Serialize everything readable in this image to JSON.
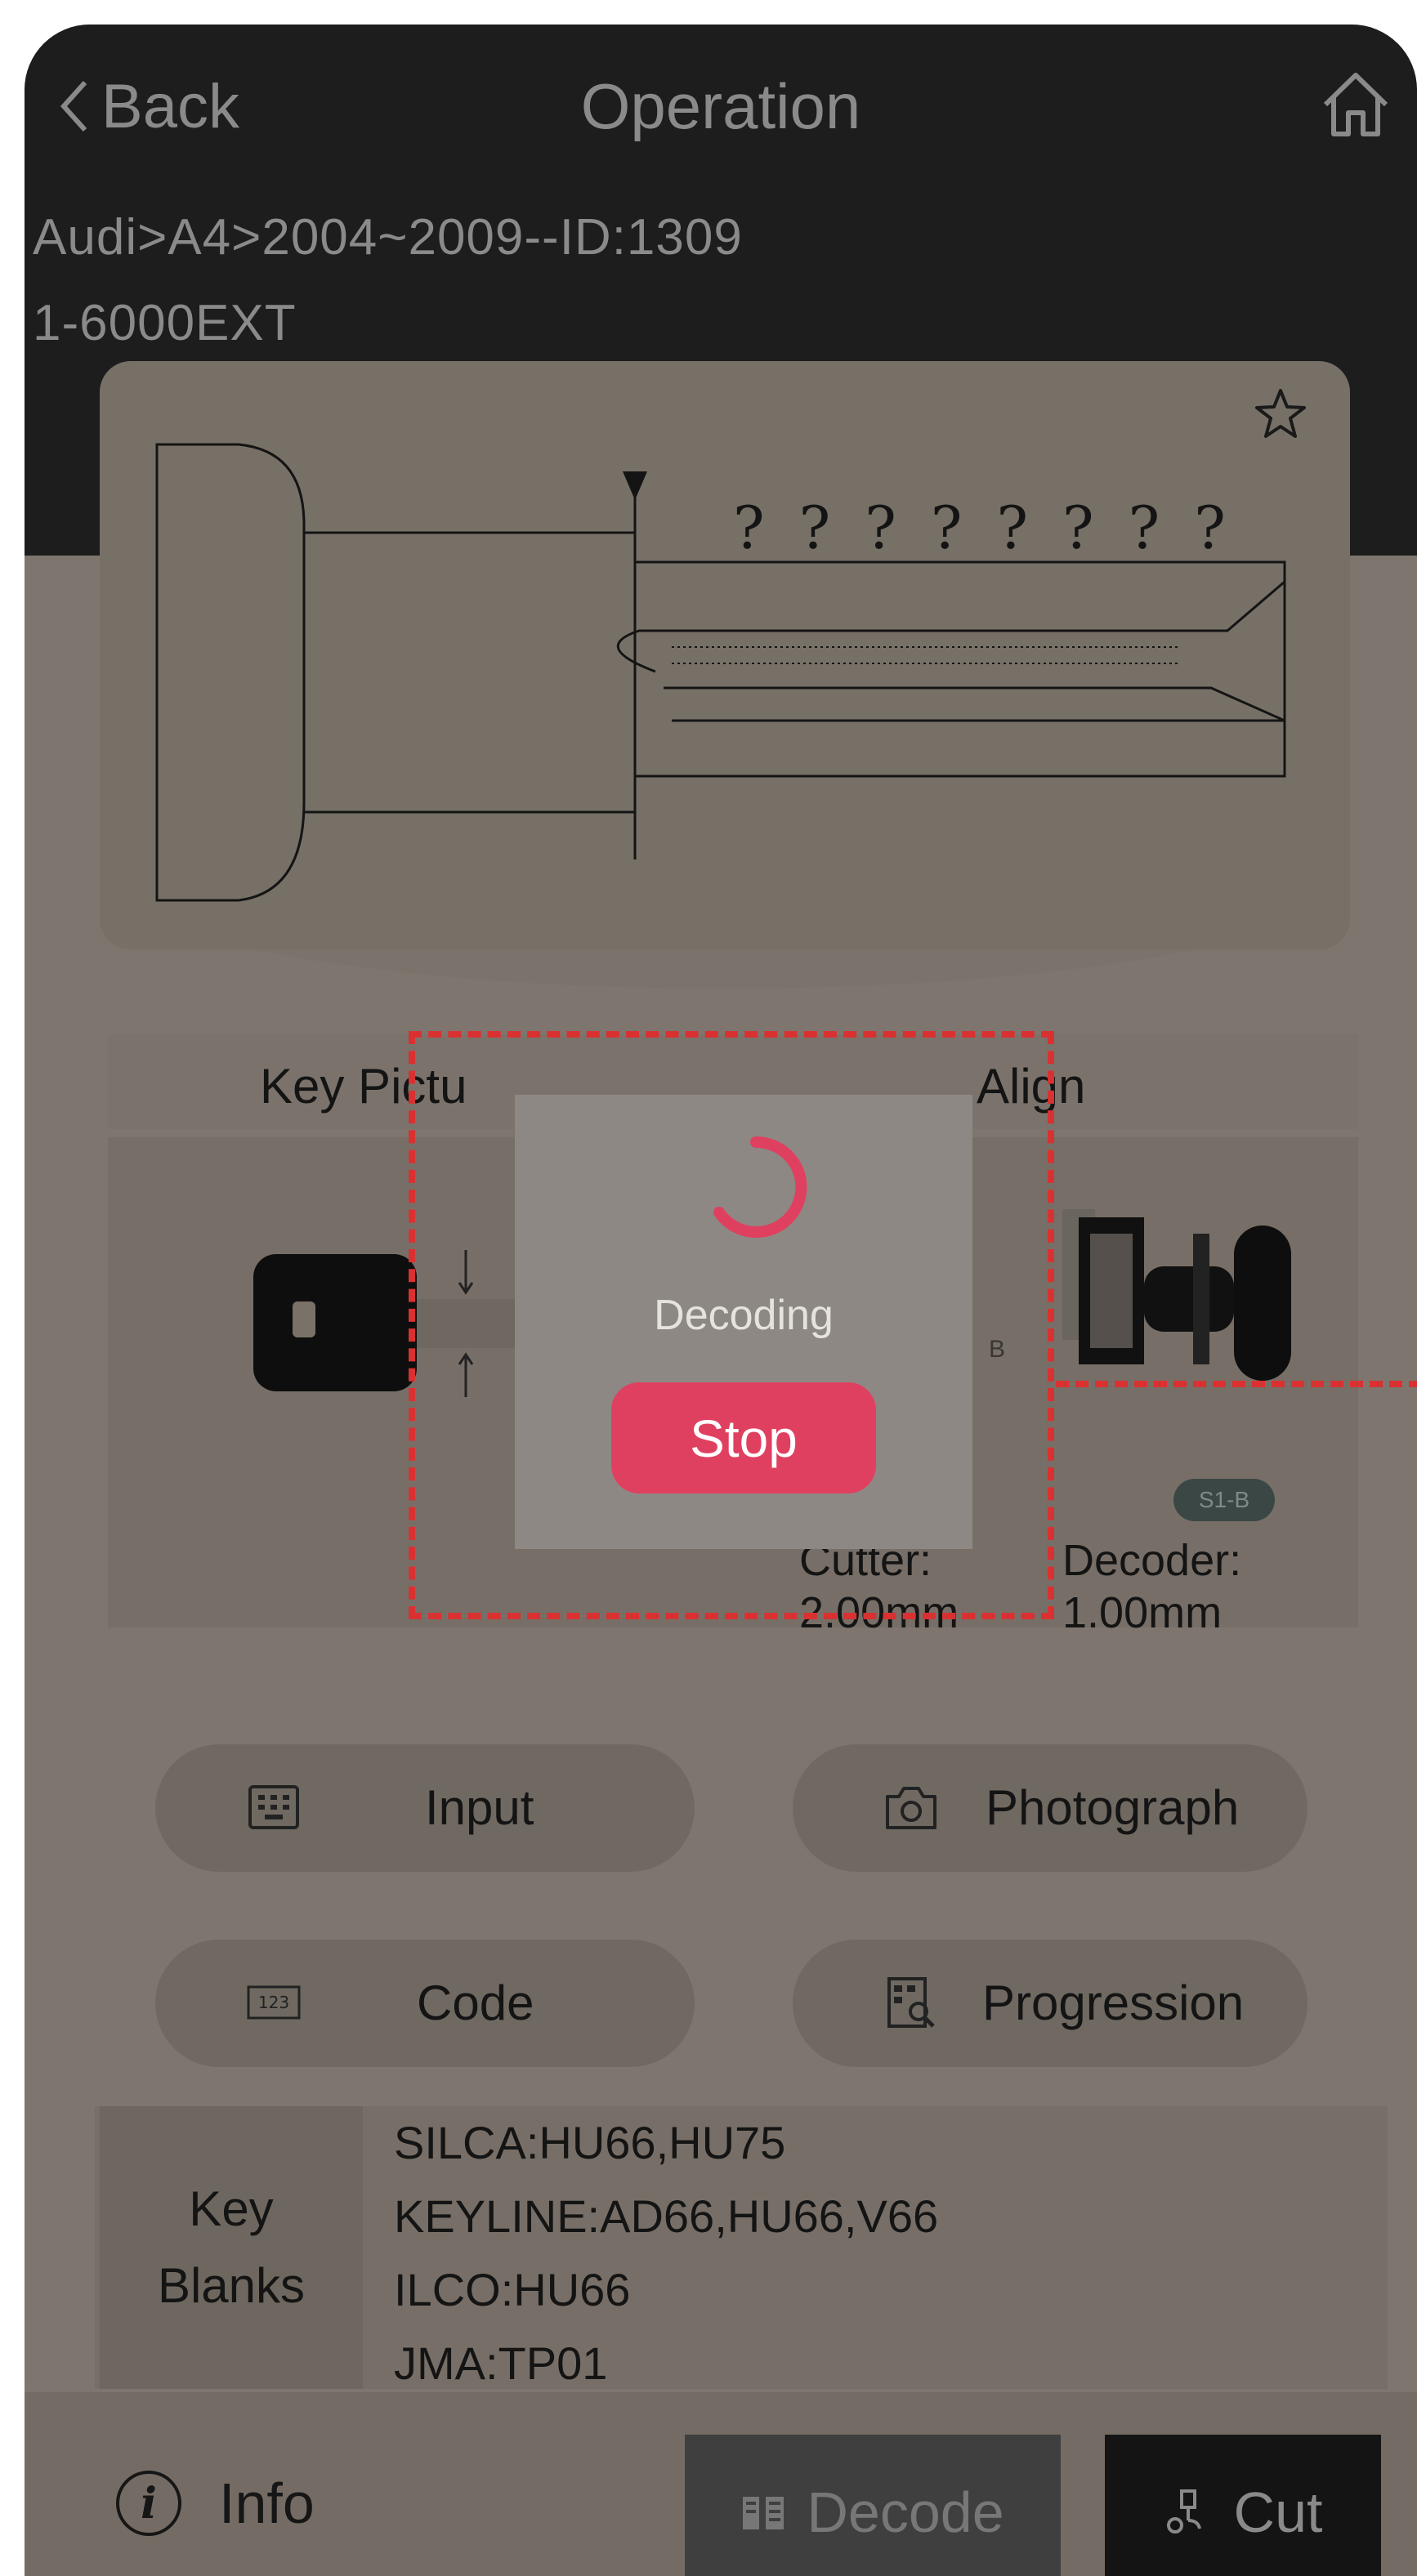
{
  "nav": {
    "back_label": "Back",
    "title": "Operation"
  },
  "breadcrumb": {
    "line1": "Audi>A4>2004~2009--ID:1309",
    "line2": "1-6000EXT"
  },
  "key_drawing": {
    "cut_marks": [
      "?",
      "?",
      "?",
      "?",
      "?",
      "?",
      "?",
      "?"
    ]
  },
  "key_panel": {
    "picture_label": "Key Pictu",
    "align_label": "Align",
    "clamp_letter": "B",
    "decoder_badge": "S1-B",
    "cutter_label": "Cutter:",
    "cutter_value": "2.00mm",
    "decoder_label": "Decoder:",
    "decoder_value": "1.00mm"
  },
  "modal": {
    "status": "Decoding",
    "stop_label": "Stop",
    "accent_color": "#e0405f"
  },
  "functions": {
    "input": "Input",
    "photograph": "Photograph",
    "code": "Code",
    "progression": "Progression"
  },
  "key_blanks": {
    "label_line1": "Key",
    "label_line2": "Blanks",
    "items": [
      "SILCA:HU66,HU75",
      "KEYLINE:AD66,HU66,V66",
      "ILCO:HU66",
      "JMA:TP01"
    ]
  },
  "bottom": {
    "info_label": "Info",
    "decode_label": "Decode",
    "cut_label": "Cut"
  },
  "icons": {
    "back": "chevron-left-icon",
    "home": "home-icon",
    "favorite": "star-icon",
    "input": "keypad-icon",
    "photograph": "camera-icon",
    "code": "numeric-code-icon",
    "progression": "progression-icon",
    "info": "info-icon",
    "decode": "decode-icon",
    "cut": "cut-icon"
  }
}
